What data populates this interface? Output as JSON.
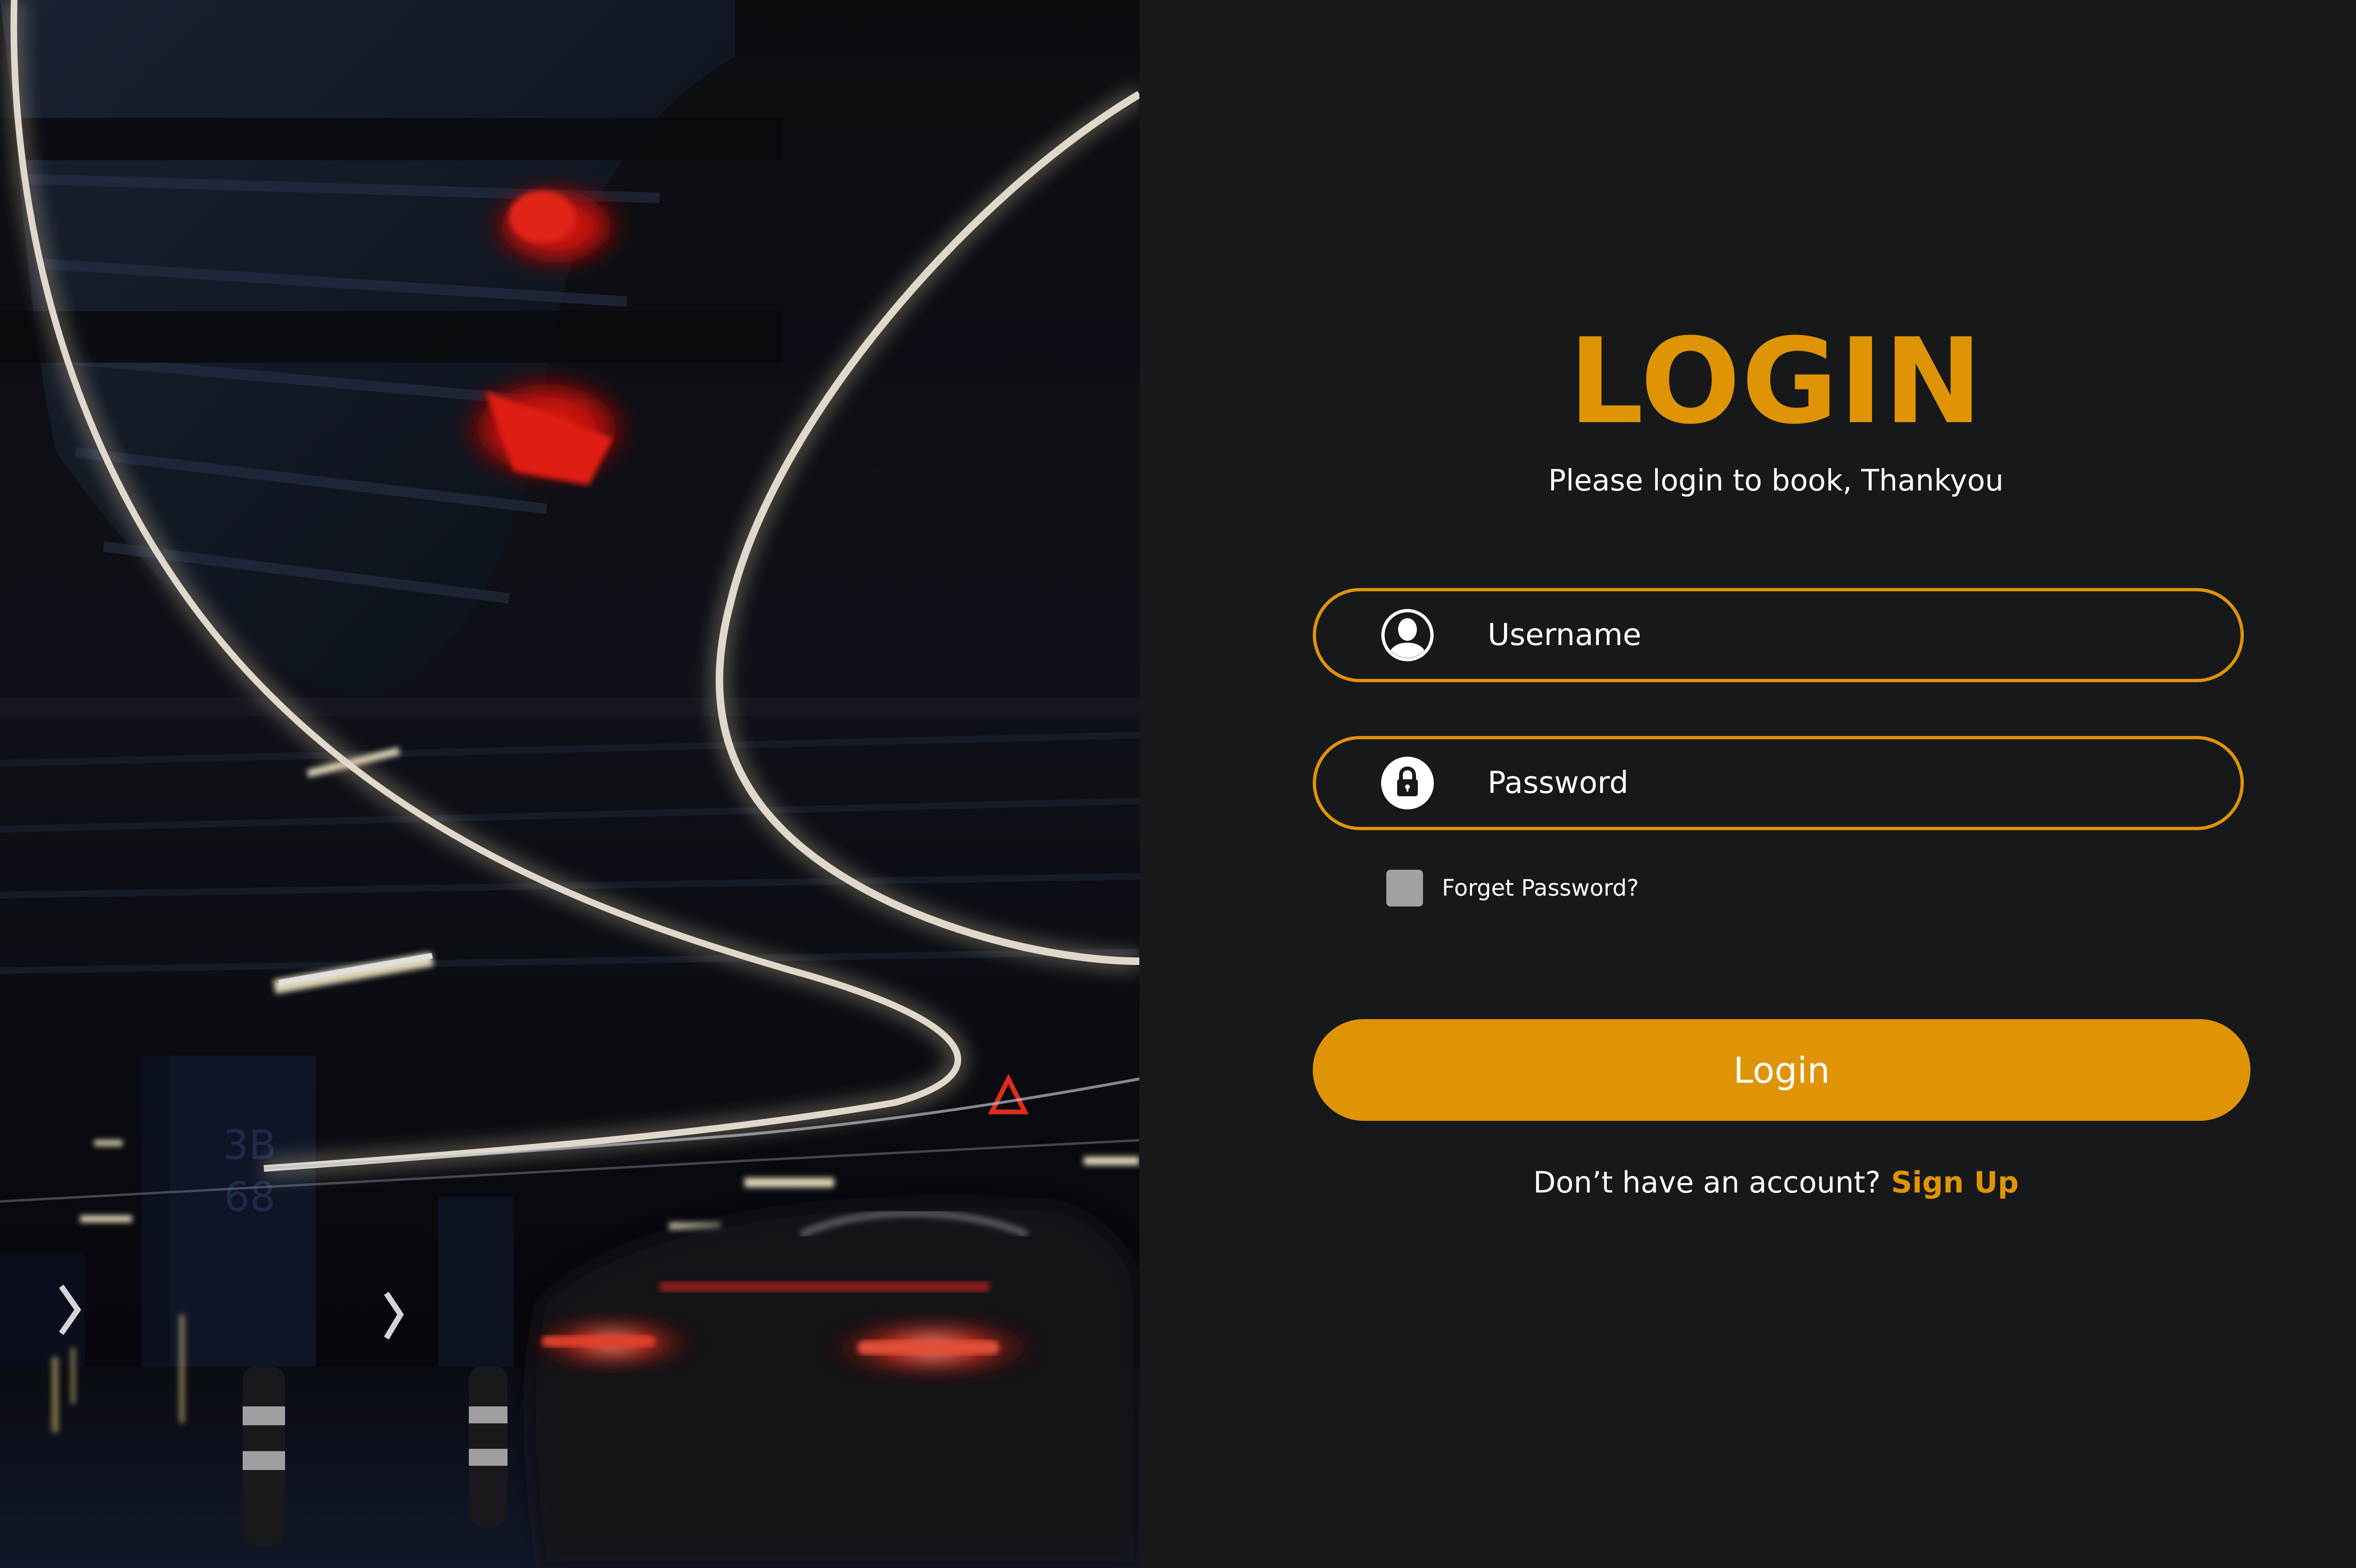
{
  "login": {
    "title": "LOGIN",
    "subtitle": "Please login to book, Thankyou",
    "username_placeholder": "Username",
    "password_placeholder": "Password",
    "forget_password_label": "Forget Password?",
    "login_button_label": "Login",
    "no_account_text": "Don’t have an account?",
    "signup_label": "Sign Up"
  },
  "hero": {
    "pillar_text_1": "3B",
    "pillar_text_2": "68"
  },
  "icons": {
    "username_icon": "user-avatar-icon",
    "password_icon": "lock-icon"
  },
  "colors": {
    "accent": "#df9406",
    "background": "#17181a",
    "text": "#ffffff",
    "checkbox": "#a1a1a1"
  }
}
